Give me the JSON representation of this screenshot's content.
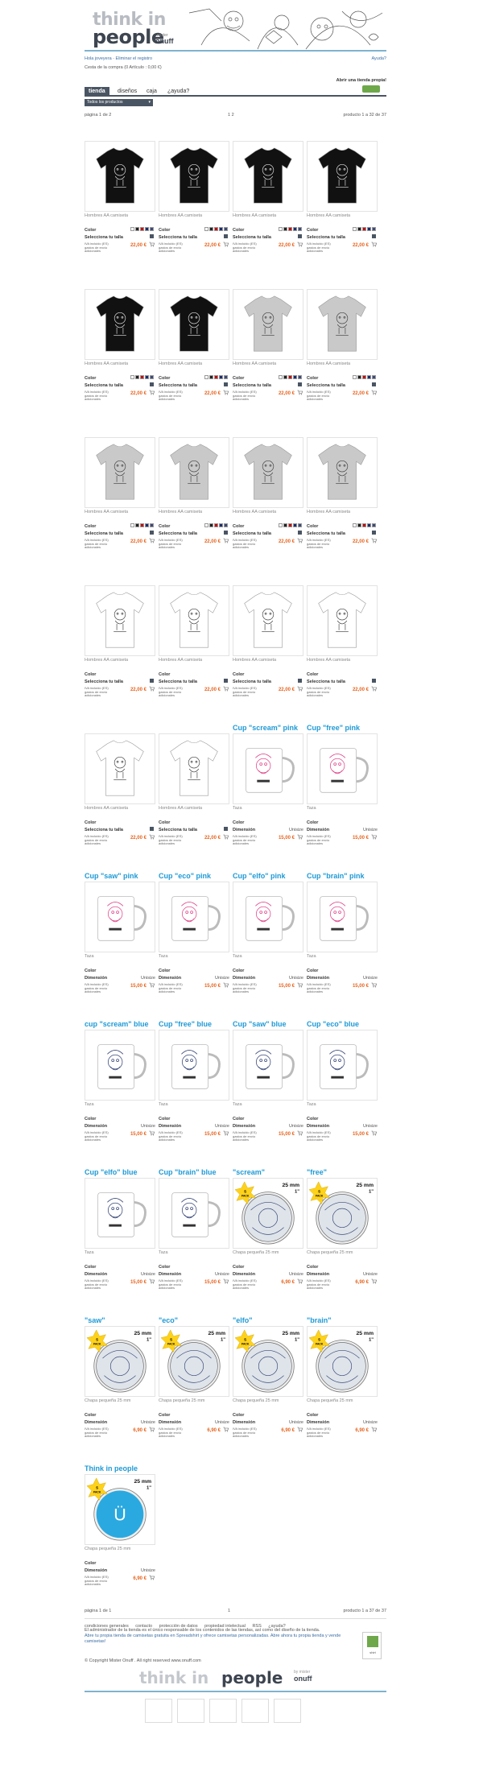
{
  "header": {
    "logo_line1": "think in",
    "logo_line2": "people",
    "logo_by": "mister",
    "logo_brand": "onuff"
  },
  "topnav": {
    "links": [
      "Hola joveyera",
      "Eliminar el registro"
    ],
    "cart": "Cesta de la compra",
    "cart_count": "(0 Artículo : 0,00 €)",
    "help": "Ayuda?",
    "open_shop": "Abrir una tienda propia!"
  },
  "tabs": [
    {
      "label": "tienda",
      "active": true
    },
    {
      "label": "diseños",
      "active": false
    },
    {
      "label": "caja",
      "active": false
    },
    {
      "label": "¿ayuda?",
      "active": false
    }
  ],
  "filter": {
    "value": "Todos los productos"
  },
  "pager_top": {
    "page": "página 1 de 2",
    "pages": "1 2",
    "count": "producto 1 a 32 de 37"
  },
  "pager_bottom": {
    "page": "página 1 de 1",
    "pages": "1",
    "count": "producto 1 a 37 de 37"
  },
  "labels": {
    "color": "Color",
    "size": "Selecciona tu talla",
    "dimension": "Dimensión",
    "unisize": "Unisize",
    "shipping": "IVA incluido (ES) gastos de envío adicionales"
  },
  "colors": {
    "accent_blue": "#1e9ad6",
    "price_orange": "#e8641e",
    "tab_dark": "#4a5563"
  },
  "products": [
    {
      "type": "Hombres AA camiseta",
      "price": "22,00 €",
      "kind": "tshirt-black",
      "swatches": [
        "#fff",
        "#222",
        "#c00",
        "#1c2c6b",
        "#3b4a7a"
      ],
      "title": ""
    },
    {
      "type": "Hombres AA camiseta",
      "price": "22,00 €",
      "kind": "tshirt-black",
      "swatches": [
        "#fff",
        "#222",
        "#c00",
        "#1c2c6b",
        "#3b4a7a"
      ],
      "title": ""
    },
    {
      "type": "Hombres AA camiseta",
      "price": "22,00 €",
      "kind": "tshirt-black",
      "swatches": [
        "#fff",
        "#222",
        "#c00",
        "#1c2c6b",
        "#3b4a7a"
      ],
      "title": ""
    },
    {
      "type": "Hombres AA camiseta",
      "price": "22,00 €",
      "kind": "tshirt-black",
      "swatches": [
        "#fff",
        "#222",
        "#c00",
        "#1c2c6b",
        "#3b4a7a"
      ],
      "title": ""
    },
    {
      "type": "Hombres AA camiseta",
      "price": "22,00 €",
      "kind": "tshirt-black",
      "swatches": [
        "#fff",
        "#222",
        "#c00",
        "#1c2c6b",
        "#3b4a7a"
      ],
      "title": ""
    },
    {
      "type": "Hombres AA camiseta",
      "price": "22,00 €",
      "kind": "tshirt-black",
      "swatches": [
        "#fff",
        "#222",
        "#c00",
        "#1c2c6b",
        "#3b4a7a"
      ],
      "title": ""
    },
    {
      "type": "Hombres AA camiseta",
      "price": "22,00 €",
      "kind": "tshirt-grey",
      "swatches": [
        "#fff",
        "#222",
        "#c00",
        "#1c2c6b",
        "#3b4a7a"
      ],
      "title": ""
    },
    {
      "type": "Hombres AA camiseta",
      "price": "22,00 €",
      "kind": "tshirt-grey",
      "swatches": [
        "#fff",
        "#222",
        "#c00",
        "#1c2c6b",
        "#3b4a7a"
      ],
      "title": ""
    },
    {
      "type": "Hombres AA camiseta",
      "price": "22,00 €",
      "kind": "tshirt-grey",
      "swatches": [
        "#fff",
        "#222",
        "#c00",
        "#1c2c6b",
        "#3b4a7a"
      ],
      "title": ""
    },
    {
      "type": "Hombres AA camiseta",
      "price": "22,00 €",
      "kind": "tshirt-grey",
      "swatches": [
        "#fff",
        "#222",
        "#c00",
        "#1c2c6b",
        "#3b4a7a"
      ],
      "title": ""
    },
    {
      "type": "Hombres AA camiseta",
      "price": "22,00 €",
      "kind": "tshirt-grey",
      "swatches": [
        "#fff",
        "#222",
        "#c00",
        "#1c2c6b",
        "#3b4a7a"
      ],
      "title": ""
    },
    {
      "type": "Hombres AA camiseta",
      "price": "22,00 €",
      "kind": "tshirt-grey",
      "swatches": [
        "#fff",
        "#222",
        "#c00",
        "#1c2c6b",
        "#3b4a7a"
      ],
      "title": ""
    },
    {
      "type": "Hombres AA camiseta",
      "price": "22,00 €",
      "kind": "tshirt-white",
      "swatches": [],
      "title": ""
    },
    {
      "type": "Hombres AA camiseta",
      "price": "22,00 €",
      "kind": "tshirt-white",
      "swatches": [],
      "title": ""
    },
    {
      "type": "Hombres AA camiseta",
      "price": "22,00 €",
      "kind": "tshirt-white",
      "swatches": [],
      "title": ""
    },
    {
      "type": "Hombres AA camiseta",
      "price": "22,00 €",
      "kind": "tshirt-white",
      "swatches": [],
      "title": ""
    },
    {
      "type": "Hombres AA camiseta",
      "price": "22,00 €",
      "kind": "tshirt-white",
      "swatches": [],
      "title": ""
    },
    {
      "type": "Hombres AA camiseta",
      "price": "22,00 €",
      "kind": "tshirt-white",
      "swatches": [],
      "title": ""
    },
    {
      "type": "Taza",
      "price": "15,00 €",
      "kind": "mug-pink",
      "swatches": [],
      "title": "Cup \"scream\" pink"
    },
    {
      "type": "Taza",
      "price": "15,00 €",
      "kind": "mug-pink",
      "swatches": [],
      "title": "Cup \"free\" pink"
    },
    {
      "type": "Taza",
      "price": "15,00 €",
      "kind": "mug-pink",
      "swatches": [],
      "title": "Cup \"saw\" pink"
    },
    {
      "type": "Taza",
      "price": "15,00 €",
      "kind": "mug-pink",
      "swatches": [],
      "title": "Cup \"eco\" pink"
    },
    {
      "type": "Taza",
      "price": "15,00 €",
      "kind": "mug-pink",
      "swatches": [],
      "title": "Cup \"elfo\" pink"
    },
    {
      "type": "Taza",
      "price": "15,00 €",
      "kind": "mug-pink",
      "swatches": [],
      "title": "Cup \"brain\" pink"
    },
    {
      "type": "Taza",
      "price": "15,00 €",
      "kind": "mug-blue",
      "swatches": [],
      "title": "cup \"scream\" blue"
    },
    {
      "type": "Taza",
      "price": "15,00 €",
      "kind": "mug-blue",
      "swatches": [],
      "title": "Cup \"free\" blue"
    },
    {
      "type": "Taza",
      "price": "15,00 €",
      "kind": "mug-blue",
      "swatches": [],
      "title": "Cup \"saw\" blue"
    },
    {
      "type": "Taza",
      "price": "15,00 €",
      "kind": "mug-blue",
      "swatches": [],
      "title": "Cup \"eco\" blue"
    },
    {
      "type": "Taza",
      "price": "15,00 €",
      "kind": "mug-blue",
      "swatches": [],
      "title": "Cup \"elfo\" blue"
    },
    {
      "type": "Taza",
      "price": "15,00 €",
      "kind": "mug-blue",
      "swatches": [],
      "title": "Cup \"brain\" blue"
    },
    {
      "type": "Chapa pequeña 25 mm",
      "price": "6,90 €",
      "kind": "badge",
      "swatches": [],
      "title": "\"scream\""
    },
    {
      "type": "Chapa pequeña 25 mm",
      "price": "6,90 €",
      "kind": "badge",
      "swatches": [],
      "title": "\"free\""
    },
    {
      "type": "Chapa pequeña 25 mm",
      "price": "6,90 €",
      "kind": "badge",
      "swatches": [],
      "title": "\"saw\""
    },
    {
      "type": "Chapa pequeña 25 mm",
      "price": "6,90 €",
      "kind": "badge",
      "swatches": [],
      "title": "\"eco\""
    },
    {
      "type": "Chapa pequeña 25 mm",
      "price": "6,90 €",
      "kind": "badge",
      "swatches": [],
      "title": "\"elfo\""
    },
    {
      "type": "Chapa pequeña 25 mm",
      "price": "6,90 €",
      "kind": "badge",
      "swatches": [],
      "title": "\"brain\""
    },
    {
      "type": "Chapa pequeña 25 mm",
      "price": "6,90 €",
      "kind": "badge-logo",
      "swatches": [],
      "title": "Think in people"
    }
  ],
  "badge_pack": {
    "pack": "5 PACK",
    "size": "25 mm",
    "inch": "1\""
  },
  "footer": {
    "links": [
      "condiciones generales",
      "contacto",
      "protección de datos",
      "propiedad intelectual",
      "RSS",
      "¿ayuda?"
    ],
    "text1": "El administrador de la tienda es el único responsable de los contenidos de las tiendas, así como del diseño de la tienda.",
    "text2": "Abre tu propia tienda de camisetas gratuita en Spreadshirt y ofrece camisetas personalizadas.",
    "text3": "Abre ahora tu propia tienda y vende camisetas!",
    "copyright": "© Copyright Mister Onuff . All right reserved www.onuff.com",
    "logo_think": "think in",
    "logo_people": "people",
    "logo_by": "by mister",
    "logo_brand": "onuff"
  }
}
